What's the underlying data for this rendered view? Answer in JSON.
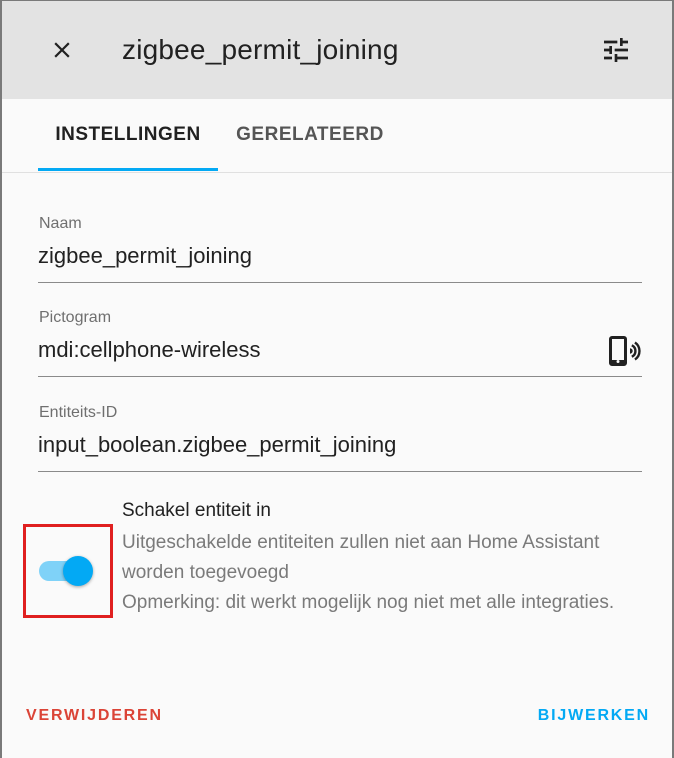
{
  "header": {
    "title": "zigbee_permit_joining",
    "close_icon": "close-icon",
    "settings_icon": "tune-icon"
  },
  "tabs": [
    {
      "label": "INSTELLINGEN",
      "active": true
    },
    {
      "label": "GERELATEERD",
      "active": false
    }
  ],
  "fields": {
    "name": {
      "label": "Naam",
      "value": "zigbee_permit_joining"
    },
    "icon": {
      "label": "Pictogram",
      "value": "mdi:cellphone-wireless",
      "preview_icon": "cellphone-wireless-icon"
    },
    "entity_id": {
      "label": "Entiteits-ID",
      "value": "input_boolean.zigbee_permit_joining"
    }
  },
  "enable_toggle": {
    "checked": true,
    "title": "Schakel entiteit in",
    "description": "Uitgeschakelde entiteiten zullen niet aan Home Assistant worden toegevoegd",
    "note": "Opmerking: dit werkt mogelijk nog niet met alle integraties."
  },
  "actions": {
    "delete_label": "VERWIJDEREN",
    "update_label": "BIJWERKEN"
  },
  "colors": {
    "accent": "#03a9f4",
    "danger": "#db4437",
    "highlight_box": "#e02020"
  }
}
